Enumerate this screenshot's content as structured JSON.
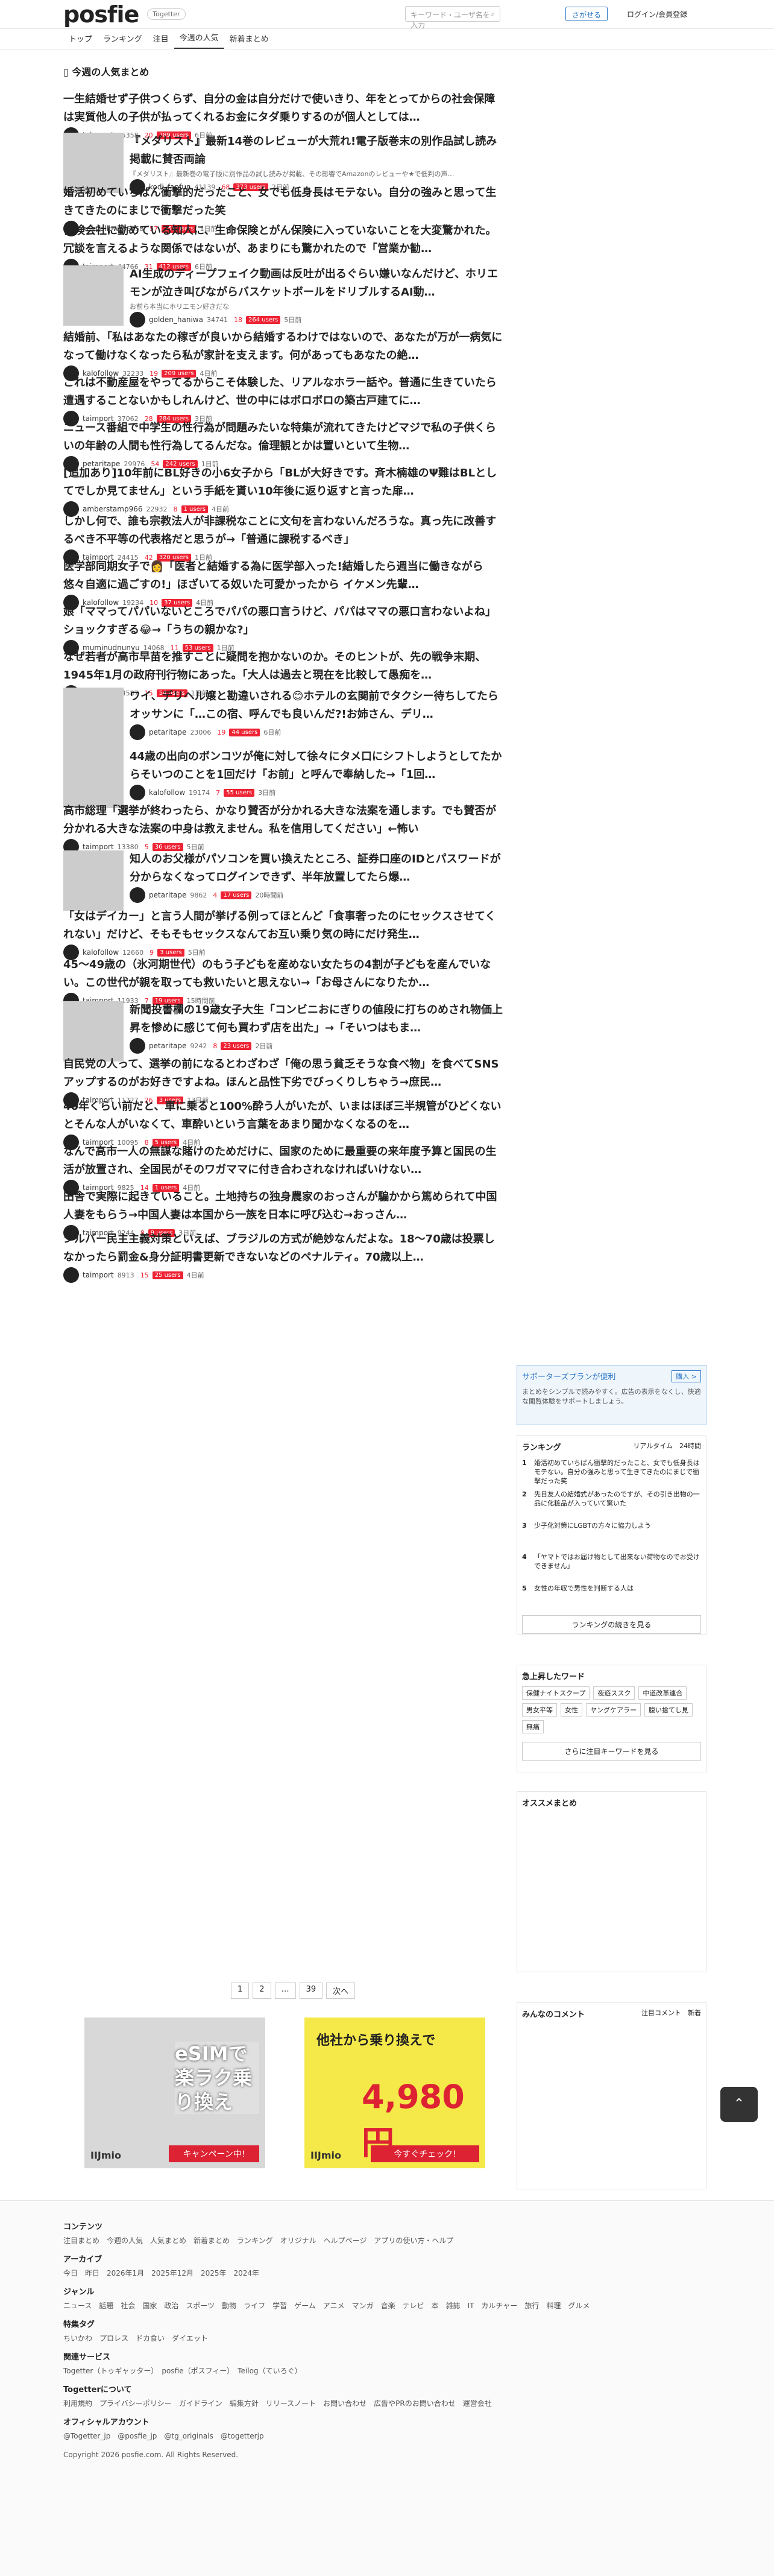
{
  "header": {
    "logo": "posfie",
    "logo_sub": "Togetter",
    "search_placeholder": "キーワード・ユーザ名を入力",
    "search_button": "さがせる",
    "login": "ログイン/会員登録"
  },
  "nav": [
    "トップ",
    "ランキング",
    "注目",
    "今週の人気",
    "新着まとめ"
  ],
  "section_title": "今週の人気まとめ",
  "items": [
    {
      "title": "一生結婚せず子供つくらず、自分の金は自分だけで使いきり、年をとってからの社会保障は実質他人の子供が払ってくれるお金にタダ乗りするのが個人としては…",
      "user": "taimport",
      "views": "45358",
      "count": "20",
      "badge": "789 users",
      "ago": "6日前"
    },
    {
      "title": "『メダリスト』最新14巻のレビューが大荒れ!電子版巻末の別作品試し読み掲載に賛否両論",
      "sub": "『メダリスト』最新巻の電子版に別作品の試し読みが掲載、その影響でAmazonのレビューや★で低判の声…",
      "user": "kodi_fanfun",
      "views": "41139",
      "count": "68",
      "badge": "373 users",
      "ago": "2日前"
    },
    {
      "title": "婚活初めていちばん衝撃的だったこと、女でも低身長はモテない。自分の強みと思って生きてきたのにまじで衝撃だった笑",
      "user": "kalofollow",
      "views": "35258",
      "count": "57",
      "badge": "158 users",
      "ago": "1日前"
    },
    {
      "title": "保険会社に勤めている知人に、生命保険とがん保険に入っていないことを大変驚かれた。冗談を言えるような関係ではないが、あまりにも驚かれたので「営業か勧…",
      "user": "taimport",
      "views": "44766",
      "count": "31",
      "badge": "412 users",
      "ago": "6日前"
    },
    {
      "title": "AI生成のディープフェイク動画は反吐が出るぐらい嫌いなんだけど、ホリエモンが泣き叫びながらバスケットボールをドリブルするAI動…",
      "sub": "お前ら本当にホリエモン好きだな",
      "user": "golden_haniwa",
      "views": "34741",
      "count": "18",
      "badge": "264 users",
      "ago": "5日前"
    },
    {
      "title": "結婚前、「私はあなたの稼ぎが良いから結婚するわけではないので、あなたが万が一病気になって働けなくなったら私が家計を支えます。何があってもあなたの絶…",
      "user": "kalofollow",
      "views": "32233",
      "count": "19",
      "badge": "209 users",
      "ago": "4日前"
    },
    {
      "title": "これは不動産屋をやってるからこそ体験した、リアルなホラー話や。普通に生きていたら遭遇することないかもしれんけど、世の中にはボロボロの築古戸建てに…",
      "user": "taimport",
      "views": "37062",
      "count": "28",
      "badge": "284 users",
      "ago": "3日前"
    },
    {
      "title": "ニュース番組で中学生の性行為が問題みたいな特集が流れてきたけどマジで私の子供くらいの年齢の人間も性行為してるんだな。倫理観とかは置いといて生物…",
      "user": "petaritape",
      "views": "29976",
      "count": "54",
      "badge": "242 users",
      "ago": "1日前"
    },
    {
      "title": "[追加あり]10年前にBL好きの小6女子から「BLが大好きです。斉木楠雄のΨ難はBLとしてでしか見てません」という手紙を貰い10年後に返り返すと言った扉…",
      "user": "amberstamp966",
      "views": "22932",
      "count": "8",
      "badge": "1 users",
      "ago": "4日前"
    },
    {
      "title": "しかし何で、誰も宗教法人が非課税なことに文句を言わないんだろうな。真っ先に改善するべき不平等の代表格だと思うが→「普通に課税するべき」",
      "user": "taimport",
      "views": "24415",
      "count": "42",
      "badge": "320 users",
      "ago": "1日前"
    },
    {
      "title": "医学部同期女子で👩「医者と結婚する為に医学部入った!結婚したら週当に働きながら悠々自適に過ごすの!」ほざいてる奴いた可愛かったから イケメン先輩…",
      "user": "kalofollow",
      "views": "19234",
      "count": "10",
      "badge": "37 users",
      "ago": "4日前"
    },
    {
      "title": "娘「ママってパパいないところでパパの悪口言うけど、パパはママの悪口言わないよね」ショックすぎる😂→「うちの親かな?」",
      "user": "muminudnunyu",
      "views": "14068",
      "count": "11",
      "badge": "53 users",
      "ago": "1日前"
    },
    {
      "title": "なぜ若者が高市早苗を推すことに疑問を抱かないのか。そのヒントが、先の戦争末期、1945年1月の政府刊行物にあった。「大人は過去と現在を比較して愚痴を…",
      "user": "taimport",
      "views": "24587",
      "count": "15",
      "badge": "54 users",
      "ago": "1日前"
    },
    {
      "title": "ワイ、デリヘル嬢と勘違いされる😊ホテルの玄関前でタクシー待ちしてたらオッサンに「…この宿、呼んでも良いんだ?!お姉さん、デリ…",
      "user": "petaritape",
      "views": "23006",
      "count": "19",
      "badge": "44 users",
      "ago": "6日前"
    },
    {
      "title": "44歳の出向のボンコツが俺に対して徐々にタメ口にシフトしようとしてたからそいつのことを1回だけ「お前」と呼んで奉納した→「1回…",
      "user": "kalofollow",
      "views": "19174",
      "count": "7",
      "badge": "55 users",
      "ago": "3日前"
    },
    {
      "title": "高市総理「選挙が終わったら、かなり賛否が分かれる大きな法案を通します。でも賛否が分かれる大きな法案の中身は教えません。私を信用してください」←怖い",
      "user": "taimport",
      "views": "13380",
      "count": "5",
      "badge": "36 users",
      "ago": "5日前"
    },
    {
      "title": "知人のお父様がパソコンを買い換えたところ、証券口座のIDとパスワードが分からなくなってログインできず、半年放置してたら爆…",
      "user": "petaritape",
      "views": "9862",
      "count": "4",
      "badge": "17 users",
      "ago": "20時間前"
    },
    {
      "title": "「女はデイカー」と言う人間が挙げる例ってほとんど「食事奢ったのにセックスさせてくれない」だけど、そもそもセックスなんてお互い乗り気の時にだけ発生…",
      "user": "kalofollow",
      "views": "12660",
      "count": "9",
      "badge": "3 users",
      "ago": "5日前"
    },
    {
      "title": "45〜49歳の（氷河期世代）のもう子どもを産めない女たちの4割が子どもを産んでいない。この世代が親を取っても救いたいと思えない→「お母さんになりたか…",
      "user": "taimport",
      "views": "11933",
      "count": "7",
      "badge": "19 users",
      "ago": "15時間前"
    },
    {
      "title": "新聞投書欄の19歳女子大生「コンビニおにぎりの値段に打ちのめされ物価上昇を惨めに感じて何も買わず店を出た」→「そいつはもま…",
      "user": "petaritape",
      "views": "9242",
      "count": "8",
      "badge": "23 users",
      "ago": "2日前"
    },
    {
      "title": "自民党の人って、選挙の前になるとわざわざ「俺の思う貧乏そうな食べ物」を食べてSNSアップするのがお好きですよね。ほんと品性下劣でびっくりしちゃう→庶民…",
      "user": "taimport",
      "views": "11727",
      "count": "26",
      "badge": "3 users",
      "ago": "13日前"
    },
    {
      "title": "40年くらい前だと、車に乗ると100%酔う人がいたが、いまはほぼ三半規管がひどくないとそんな人がいなくて、車酔いという言葉をあまり聞かなくなるのを…",
      "user": "taimport",
      "views": "10095",
      "count": "8",
      "badge": "5 users",
      "ago": "4日前"
    },
    {
      "title": "なんで高市一人の無謀な賭けのためだけに、国家のために最重要の来年度予算と国民の生活が放置され、全国民がそのワガママに付き合わされなければいけない…",
      "user": "taimport",
      "views": "9825",
      "count": "14",
      "badge": "1 users",
      "ago": "4日前"
    },
    {
      "title": "田舎で実際に起きていること。土地持ちの独身農家のおっさんが騙かから篤められて中国人妻をもらう→中国人妻は本国から一族を日本に呼び込む→おっさん…",
      "user": "taimport",
      "views": "9244",
      "count": "8",
      "badge": "9 users",
      "ago": "3日前"
    },
    {
      "title": "シルバー民主主義対策といえば、ブラジルの方式が絶妙なんだよな。18〜70歳は投票しなかったら罰金&身分証明書更新できないなどのペナルティ。70歳以上…",
      "user": "taimport",
      "views": "8913",
      "count": "15",
      "badge": "25 users",
      "ago": "4日前"
    }
  ],
  "pager": [
    "1",
    "2",
    "…",
    "39",
    "次へ"
  ],
  "ads": [
    {
      "big": "eSIMで楽ラク乗り換え",
      "small": "IIJmio",
      "cta": "キャンペーン中!"
    },
    {
      "big": "他社から乗り換えで",
      "price": "4,980円",
      "small": "IIJmio",
      "cta": "今すぐチェック!"
    }
  ],
  "side": {
    "support_title": "サポーターズプランが便利",
    "support_btn": "購入 >",
    "support_text": "まとめをシンプルで読みやすく。広告の表示をなくし、快適な閲覧体験をサポートしましょう。",
    "ranking_title": "ランキング",
    "ranking_tabs": [
      "リアルタイム",
      "24時間"
    ],
    "ranking": [
      "婚活初めていちばん衝撃的だったこと、女でも低身長はモテない。自分の強みと思って生きてきたのにまじで衝撃だった笑",
      "先日友人の結婚式があったのですが、その引き出物の一品に化粧品が入っていて驚いた",
      "少子化対策にLGBTの方々に協力しよう",
      "「ヤマトではお届け物として出来ない荷物なのでお受けできません」",
      "女性の年収で男性を判断する人は"
    ],
    "ranking_more": "ランキングの続きを見る",
    "hotwords_title": "急上昇したワード",
    "hotwords": [
      "保健ナイトスクープ",
      "夜遊ススク",
      "中道改革連合",
      "男女平等",
      "女性",
      "ヤングケアラー",
      "腹い捨てし見",
      "無痛"
    ],
    "hotwords_more": "さらに注目キーワードを見る",
    "recommend_title": "オススメまとめ",
    "comments_title": "みんなのコメント",
    "comment_tabs": [
      "注目コメント",
      "新着"
    ]
  },
  "footer": {
    "contents_h": "コンテンツ",
    "contents": "注目まとめ　今週の人気　人気まとめ　新着まとめ　ランキング　オリジナル　ヘルプページ　アプリの使い方・ヘルプ",
    "archive_h": "アーカイブ",
    "archive": "今日　昨日　2026年1月　2025年12月　2025年　2024年",
    "genre_h": "ジャンル",
    "genre": "ニュース　話題　社会　国家　政治　スポーツ　動物　ライフ　学習　ゲーム　アニメ　マンガ　音楽　テレビ　本　雑誌　IT　カルチャー　旅行　料理　グルメ",
    "tags_h": "特集タグ",
    "tags": "ちいかわ　プロレス　ドカ食い　ダイエット",
    "services_h": "関連サービス",
    "services": "Togetter（トゥギャッター）　posfie（ポスフィー）　Teilog（ていろぐ）",
    "about_h": "Togetterについて",
    "about": "利用規約　プライバシーポリシー　ガイドライン　編集方針　リリースノート　お問い合わせ　広告やPRのお問い合わせ　運営会社",
    "official_h": "オフィシャルアカウント",
    "official": "@Togetter_jp　@posfie_jp　@tg_originals　@togetterjp",
    "copyright": "Copyright 2026 posfie.com. All Rights Reserved."
  }
}
